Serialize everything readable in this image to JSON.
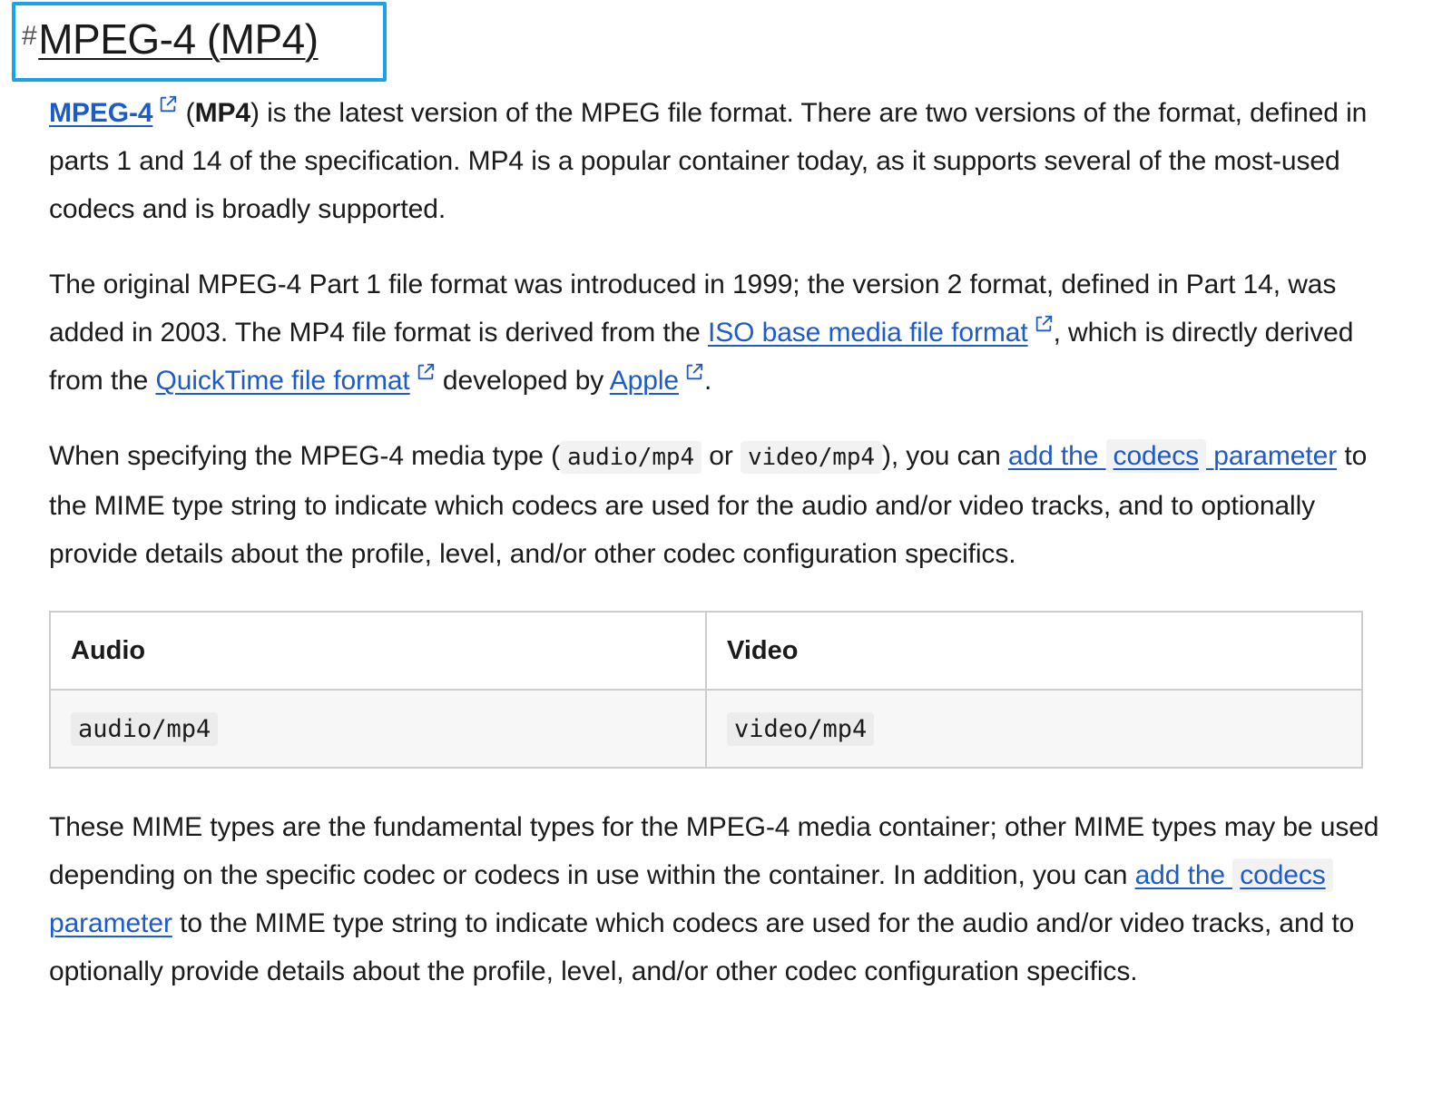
{
  "heading": {
    "hash": "#",
    "title": "MPEG-4 (MP4)"
  },
  "paragraphs": {
    "p1": {
      "link_mpeg4": "MPEG-4",
      "bold_mp4": "MP4",
      "text_a": " (",
      "text_b": ") is the latest version of the MPEG file format. There are two versions of the format, defined in parts 1 and 14 of the specification. MP4 is a popular container today, as it supports several of the most-used codecs and is broadly supported."
    },
    "p2": {
      "text_a": "The original MPEG-4 Part 1 file format was introduced in 1999; the version 2 format, defined in Part 14, was added in 2003. The MP4 file format is derived from the ",
      "link_iso": "ISO base media file format",
      "text_b": ", which is directly derived from the ",
      "link_quicktime": "QuickTime file format",
      "text_c": " developed by ",
      "link_apple": "Apple",
      "text_d": "."
    },
    "p3": {
      "text_a": "When specifying the MPEG-4 media type (",
      "code_audio": "audio/mp4",
      "text_b": " or ",
      "code_video": "video/mp4",
      "text_c": "), you can ",
      "link_add_the": "add the ",
      "link_codecs": "codecs",
      "link_parameter": " parameter",
      "text_d": " to the MIME type string to indicate which codecs are used for the audio and/or video tracks, and to optionally provide details about the profile, level, and/or other codec configuration specifics."
    },
    "p4": {
      "text_a": "These MIME types are the fundamental types for the MPEG-4 media container; other MIME types may be used depending on the specific codec or codecs in use within the container. In addition, you can ",
      "link_add_the": "add the ",
      "link_codecs": "codecs",
      "link_parameter": " parameter",
      "text_b": " to the MIME type string to indicate which codecs are used for the audio and/or video tracks, and to optionally provide details about the profile, level, and/or other codec configuration specifics."
    }
  },
  "table": {
    "headers": [
      "Audio",
      "Video"
    ],
    "rows": [
      [
        "audio/mp4",
        "video/mp4"
      ]
    ]
  },
  "icons": {
    "external_link": "external-link-icon"
  },
  "colors": {
    "link": "#1e5bc6",
    "focus_ring": "#1aa3e8",
    "text": "#1b1b1b",
    "code_bg": "#f2f2f2"
  }
}
